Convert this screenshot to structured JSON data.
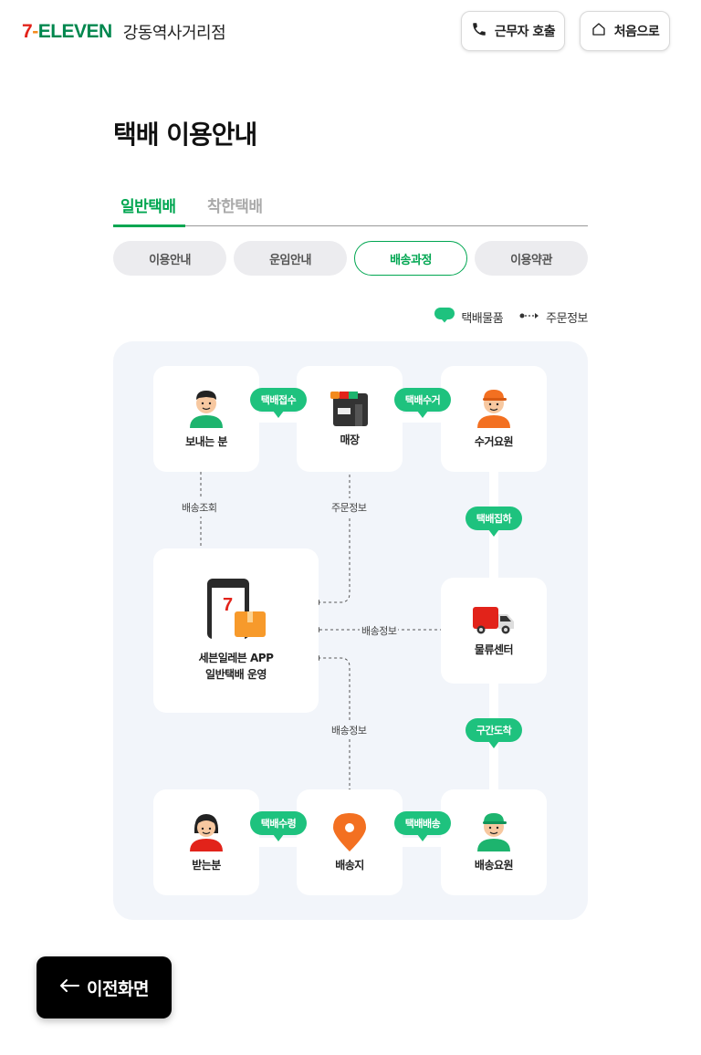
{
  "header": {
    "logo": {
      "seven": "7",
      "dash": "-",
      "eleven": "ELEVEN"
    },
    "store_name": "강동역사거리점",
    "call_button": "근무자 호출",
    "home_button": "처음으로"
  },
  "page": {
    "title": "택배 이용안내"
  },
  "tabs": [
    {
      "label": "일반택배",
      "active": true
    },
    {
      "label": "착한택배",
      "active": false
    }
  ],
  "segments": [
    {
      "label": "이용안내",
      "active": false
    },
    {
      "label": "운임안내",
      "active": false
    },
    {
      "label": "배송과정",
      "active": true
    },
    {
      "label": "이용약관",
      "active": false
    }
  ],
  "legend": {
    "parcel": "택배물품",
    "order_info": "주문정보"
  },
  "diagram": {
    "nodes": {
      "sender": "보내는 분",
      "store": "매장",
      "collector": "수거요원",
      "app_line1": "세븐일레븐 APP",
      "app_line2": "일반택배 운영",
      "logistics": "물류센터",
      "receiver": "받는분",
      "destination": "배송지",
      "courier": "배송요원"
    },
    "steps": {
      "accept": "택배접수",
      "collect": "택배수거",
      "ship": "택배집하",
      "arrive": "구간도착",
      "receive": "택배수령",
      "deliver": "택배배송"
    },
    "edges": {
      "tracking": "배송조회",
      "order_info": "주문정보",
      "delivery_info_right": "배송정보",
      "delivery_info_bottom": "배송정보"
    }
  },
  "colors": {
    "brand_green": "#00a651",
    "bubble_green": "#1ec27e",
    "seven_red": "#e2231a",
    "seven_orange": "#f38a1d",
    "diagram_bg": "#f2f5fa"
  },
  "back_button": "이전화면"
}
